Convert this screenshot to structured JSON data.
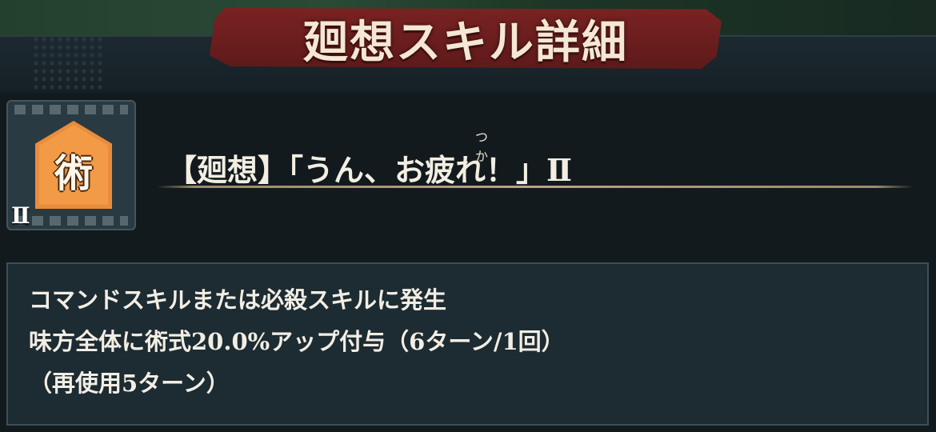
{
  "header": {
    "title": "廻想スキル詳細"
  },
  "skill": {
    "icon_char": "術",
    "rank": "Ⅱ",
    "ruby": "つか",
    "name": "【廻想】「うん、お疲れ！」Ⅱ",
    "description": [
      "コマンドスキルまたは必殺スキルに発生",
      "味方全体に術式20.0%アップ付与（6ターン/1回）",
      "（再使用5ターン）"
    ]
  },
  "icons": {
    "skill_type": "jutsu-badge-icon"
  },
  "colors": {
    "banner": "#6b1e1e",
    "badge": "#f29a45",
    "panel": "#1d2b32",
    "background": "#12191d"
  }
}
